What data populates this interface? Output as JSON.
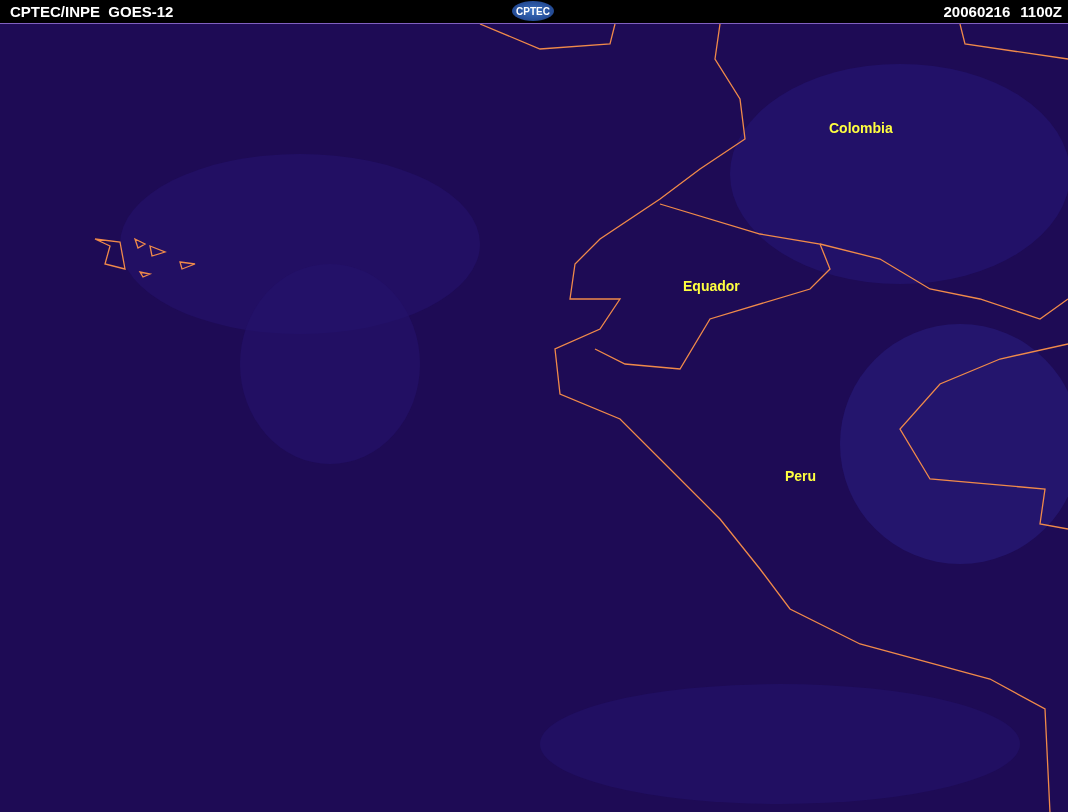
{
  "header": {
    "title": "CPTEC/INPE  GOES-12",
    "logo": "CPTEC",
    "date": "20060216",
    "time": "1100Z"
  },
  "map": {
    "labels": [
      "Colombia",
      "Equador",
      "Peru"
    ]
  }
}
